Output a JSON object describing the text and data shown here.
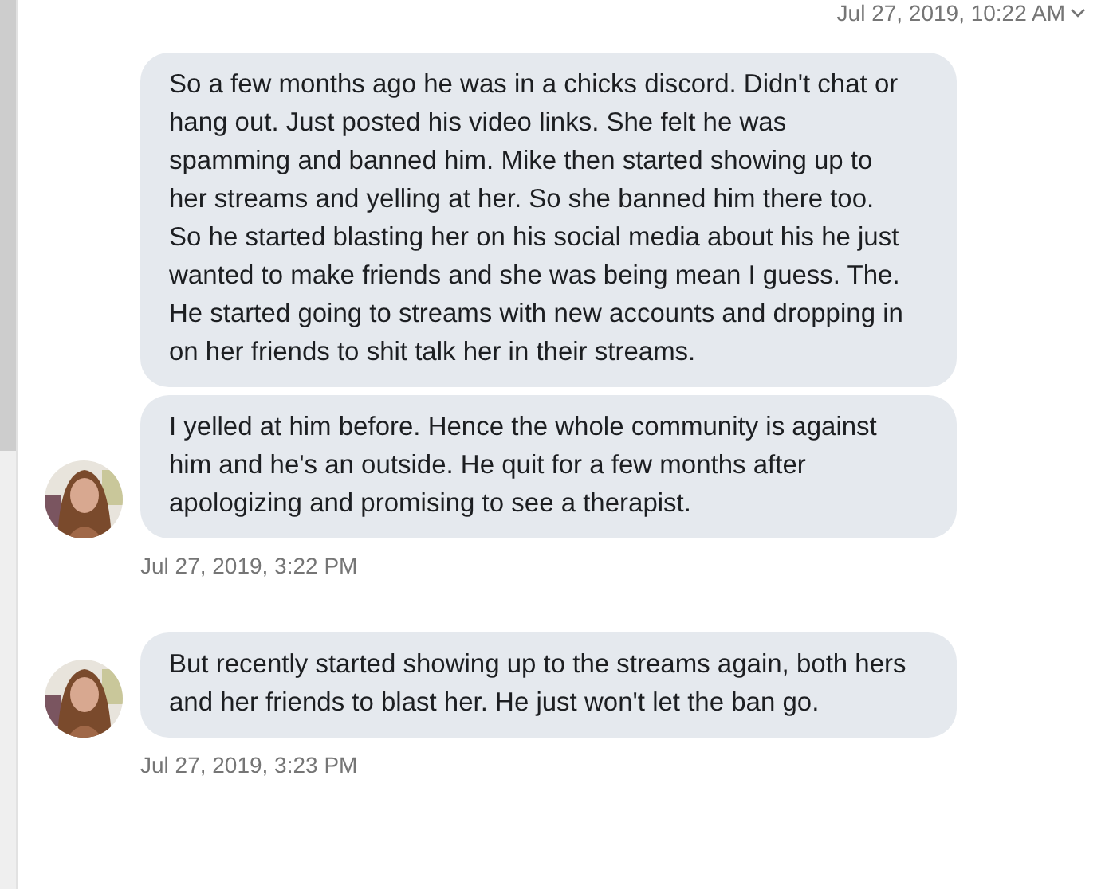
{
  "top_timestamp": "Jul 27, 2019, 10:22 AM",
  "groups": [
    {
      "messages": [
        "So a few months ago he was in a chicks discord. Didn't chat or hang out. Just posted his video links. She felt he was spamming and banned him. Mike then started showing up to her streams and yelling at her. So she banned him there too. So he started blasting her on his social media about his he just wanted to make friends and she was being mean I guess. The. He started going to streams with new accounts and dropping in on her friends to shit talk her in their streams.",
        "I yelled at him before. Hence the whole community is against him and he's an outside. He quit for a few months after apologizing and promising to see a therapist."
      ],
      "timestamp": "Jul 27, 2019, 3:22 PM"
    },
    {
      "messages": [
        "But recently started showing up to the streams again, both hers and her friends to blast her. He just won't let the ban go."
      ],
      "timestamp": "Jul 27, 2019, 3:23 PM"
    }
  ]
}
